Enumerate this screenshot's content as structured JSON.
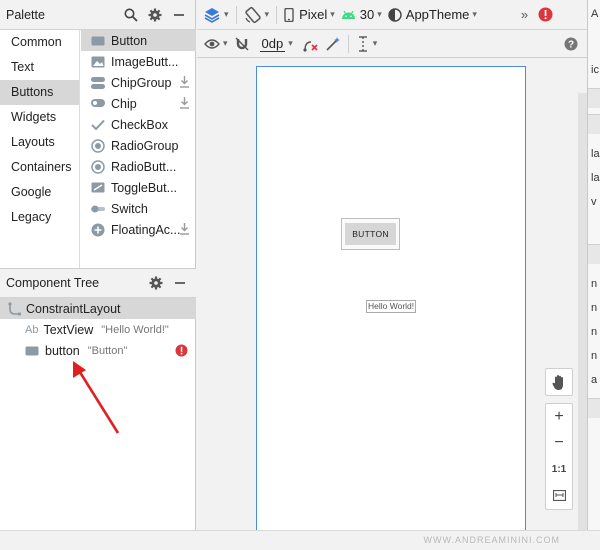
{
  "palette": {
    "title": "Palette",
    "categories": [
      "Common",
      "Text",
      "Buttons",
      "Widgets",
      "Layouts",
      "Containers",
      "Google",
      "Legacy"
    ],
    "selected_category": "Buttons",
    "widgets": [
      "Button",
      "ImageButt...",
      "ChipGroup",
      "Chip",
      "CheckBox",
      "RadioGroup",
      "RadioButt...",
      "ToggleBut...",
      "Switch",
      "FloatingAc..."
    ]
  },
  "component_tree": {
    "title": "Component Tree",
    "root": "ConstraintLayout",
    "textview": {
      "label": "TextView",
      "prefix": "Ab",
      "value": "\"Hello World!\""
    },
    "button": {
      "label": "button",
      "value": "\"Button\""
    }
  },
  "toolbar": {
    "device": "Pixel",
    "api": "30",
    "theme": "AppTheme",
    "margin": "0dp",
    "overflow": "»"
  },
  "canvas": {
    "button_text": "BUTTON",
    "hello_text": "Hello World!"
  },
  "zoom": {
    "zoom_in": "+",
    "zoom_out": "−",
    "actual_size": "1:1"
  },
  "right_panel": {
    "header": "A",
    "rows": [
      "ic",
      "la",
      "la",
      "v",
      "n",
      "n",
      "n",
      "n",
      "a"
    ]
  },
  "footer": {
    "watermark": "WWW.ANDREAMININI.COM"
  },
  "colors": {
    "accent": "#4d8fd6",
    "selection": "#d7d7d7",
    "error": "#d9363e",
    "android_green": "#3ddc84",
    "annotation_arrow": "#e02020"
  }
}
